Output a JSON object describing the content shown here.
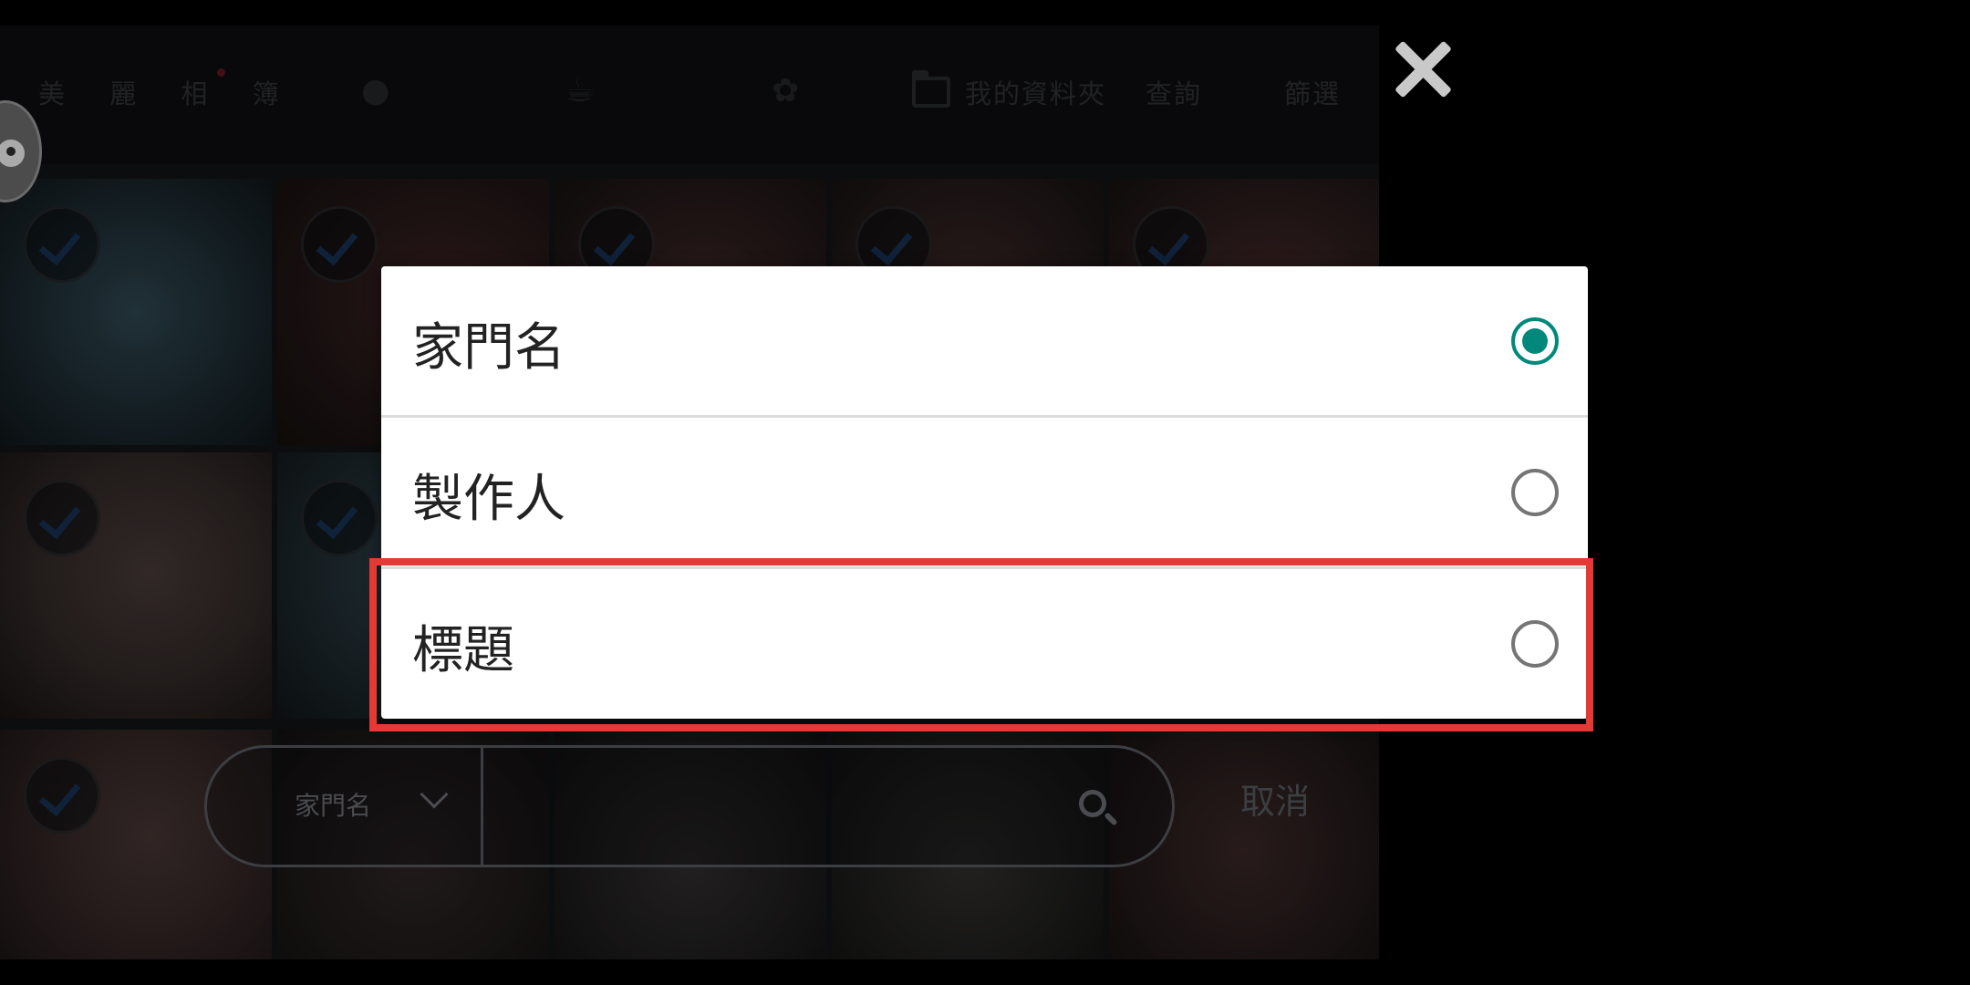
{
  "header": {
    "brand_title": "美 麗 相 簿",
    "folder_label": "我的資料夾",
    "query_label": "查詢",
    "filter_label": "篩選",
    "icons": [
      "person-icon",
      "trophy-icon",
      "award-icon",
      "folder-icon"
    ]
  },
  "search": {
    "type_label": "家門名",
    "cancel_label": "取消"
  },
  "dialog": {
    "options": [
      {
        "label": "家門名",
        "selected": true
      },
      {
        "label": "製作人",
        "selected": false
      },
      {
        "label": "標題",
        "selected": false
      }
    ]
  },
  "colors": {
    "radio_selected": "#00897b",
    "highlight": "#e53935",
    "brand_dot": "#7a1d24"
  }
}
